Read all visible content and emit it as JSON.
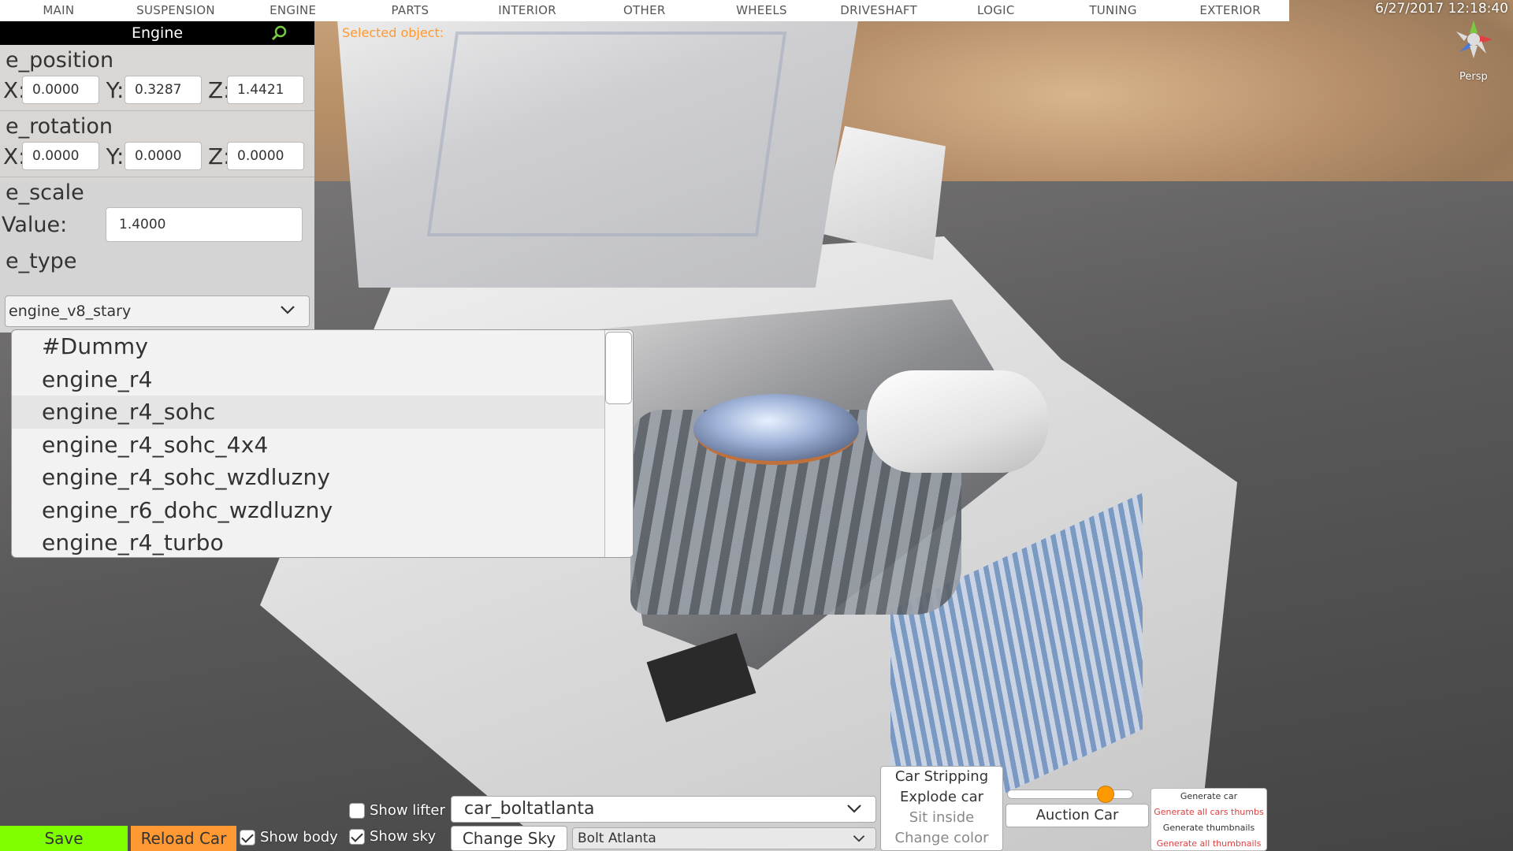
{
  "menu": {
    "tabs": [
      "MAIN",
      "SUSPENSION",
      "ENGINE",
      "PARTS",
      "INTERIOR",
      "OTHER",
      "WHEELS",
      "DRIVESHAFT",
      "LOGIC",
      "TUNING",
      "EXTERIOR"
    ]
  },
  "status": {
    "datetime": "6/27/2017 12:18:40",
    "view_mode": "Persp",
    "selected_object_label": "Selected object:"
  },
  "panel": {
    "title": "Engine",
    "position": {
      "label": "e_position",
      "x_label": "X:",
      "y_label": "Y:",
      "z_label": "Z:",
      "x": "0.0000",
      "y": "0.3287",
      "z": "1.4421"
    },
    "rotation": {
      "label": "e_rotation",
      "x_label": "X:",
      "y_label": "Y:",
      "z_label": "Z:",
      "x": "0.0000",
      "y": "0.0000",
      "z": "0.0000"
    },
    "scale": {
      "label": "e_scale",
      "value_label": "Value:",
      "value": "1.4000"
    },
    "type": {
      "label": "e_type",
      "selected": "engine_v8_stary"
    }
  },
  "dropdown": {
    "items": [
      "#Dummy",
      "engine_r4",
      "engine_r4_sohc",
      "engine_r4_sohc_4x4",
      "engine_r4_sohc_wzdluzny",
      "engine_r6_dohc_wzdluzny",
      "engine_r4_turbo"
    ],
    "highlighted_index": 2
  },
  "bottom": {
    "save_label": "Save",
    "reload_label": "Reload Car",
    "show_body_label": "Show body",
    "show_lifter_label": "Show lifter",
    "show_sky_label": "Show sky",
    "car_selected": "car_boltatlanta",
    "change_sky_label": "Change Sky",
    "sky_selected": "Bolt Atlanta",
    "actions": [
      "Car Stripping",
      "Explode car",
      "Sit inside",
      "Change color"
    ],
    "auction_label": "Auction Car",
    "slider_value": 0.82,
    "generate": [
      "Generate car",
      "Generate all cars thumbs",
      "Generate thumbnails",
      "Generate all thumbnails"
    ]
  },
  "colors": {
    "save": "#7fff00",
    "reload": "#ff9933",
    "accent": "#ff9933",
    "warning_text": "#e04040"
  }
}
